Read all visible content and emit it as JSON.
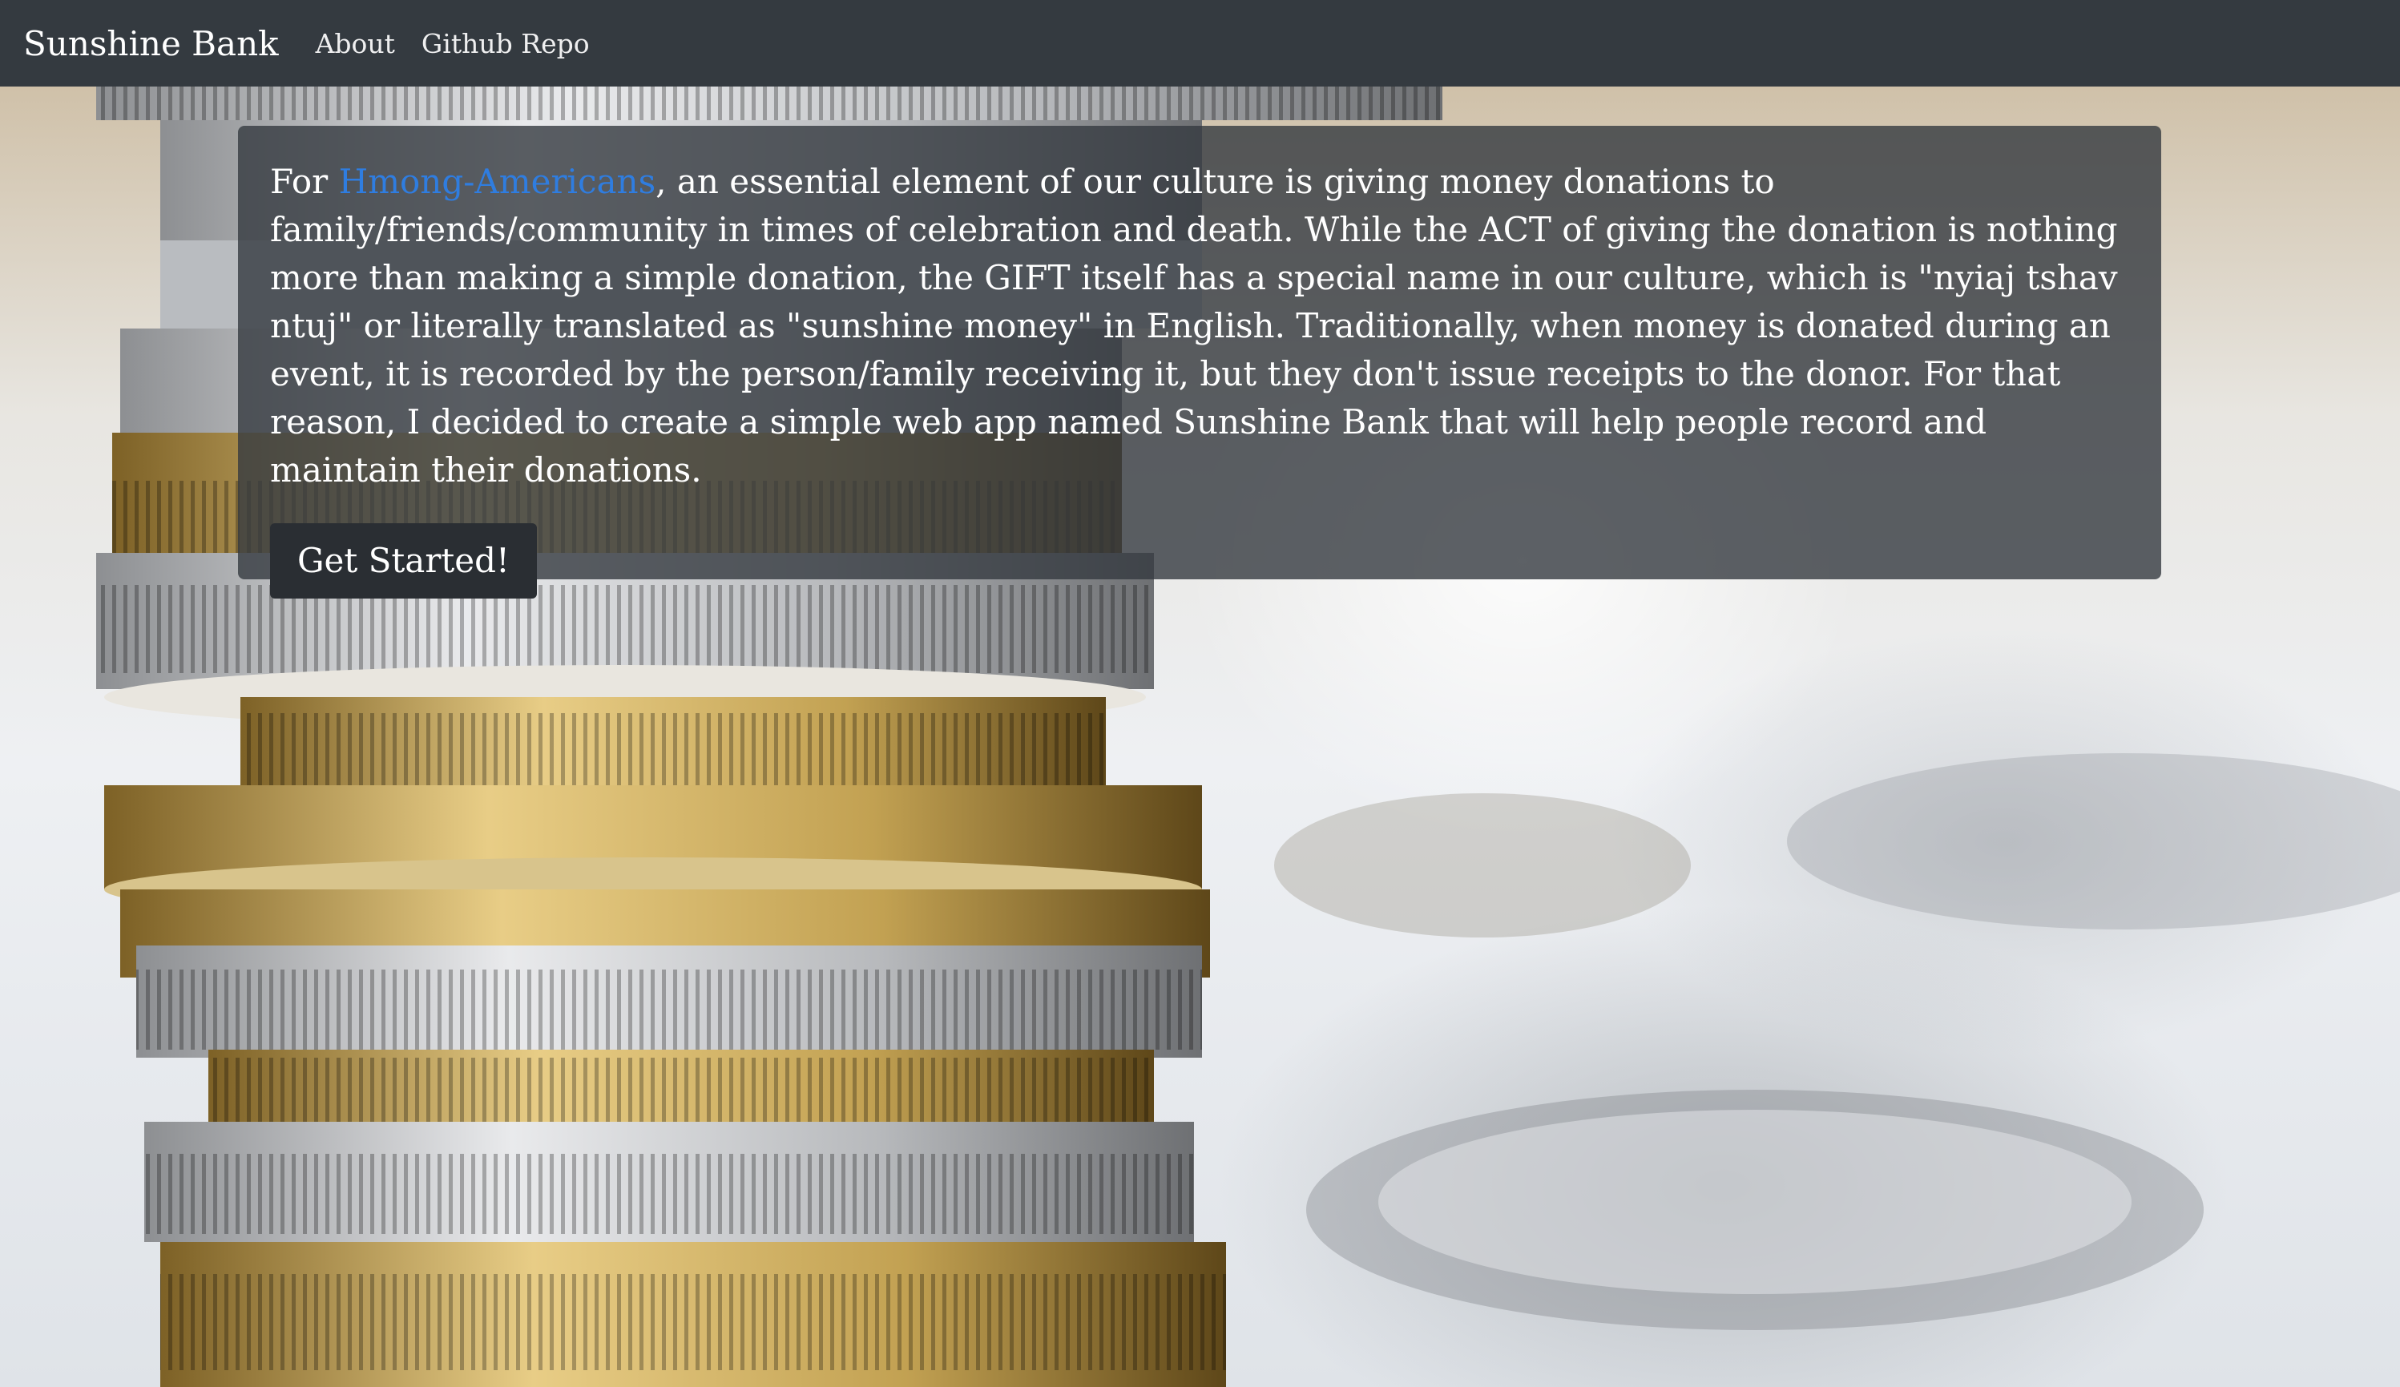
{
  "navbar": {
    "brand": "Sunshine Bank",
    "links": [
      "About",
      "Github Repo"
    ]
  },
  "jumbotron": {
    "text_before_link": "For ",
    "link_text": "Hmong-Americans",
    "text_after_link": ", an essential element of our culture is giving money donations to family/friends/community in times of celebration and death. While the ACT of giving the donation is nothing more than making a simple donation, the GIFT itself has a special name in our culture, which is \"nyiaj tshav ntuj\" or literally translated as \"sunshine money\" in English. Traditionally, when money is donated during an event, it is recorded by the person/family receiving it, but they don't issue receipts to the donor. For that reason, I decided to create a simple web app named Sunshine Bank that will help people record and maintain their donations.",
    "button_label": "Get Started!"
  },
  "colors": {
    "navbar_bg": "#343a40",
    "link": "#2f7de0",
    "button_bg": "#2a2e33"
  },
  "background": {
    "icon": "coin-stack-photo"
  }
}
